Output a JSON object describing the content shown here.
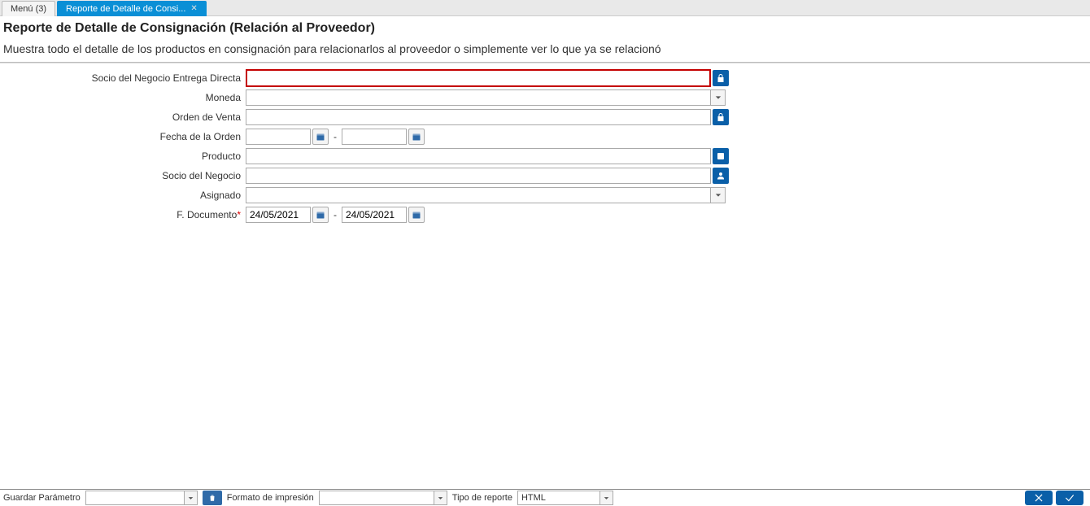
{
  "tabs": {
    "menu_label": "Menú (3)",
    "active_label": "Reporte de Detalle de Consi..."
  },
  "header": {
    "title": "Reporte de Detalle de Consignación (Relación al Proveedor)",
    "description": "Muestra todo el detalle de los productos en consignación para relacionarlos al proveedor o simplemente ver lo que ya se relacionó"
  },
  "form": {
    "socio_directa_label": "Socio del Negocio Entrega Directa",
    "moneda_label": "Moneda",
    "orden_venta_label": "Orden de Venta",
    "fecha_orden_label": "Fecha de la Orden",
    "producto_label": "Producto",
    "socio_negocio_label": "Socio del Negocio",
    "asignado_label": "Asignado",
    "f_documento_label": "F. Documento",
    "f_documento_from": "24/05/2021",
    "f_documento_to": "24/05/2021"
  },
  "footer": {
    "guardar_label": "Guardar Parámetro",
    "formato_label": "Formato de impresión",
    "tipo_label": "Tipo de reporte",
    "tipo_value": "HTML"
  }
}
